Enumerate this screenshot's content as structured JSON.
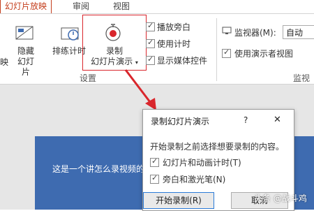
{
  "tabs": [
    {
      "label": "幻灯片放映",
      "active": true
    },
    {
      "label": "审阅",
      "active": false
    },
    {
      "label": "视图",
      "active": false
    }
  ],
  "ribbon": {
    "left_partial": "映",
    "hide_slide": {
      "line1": "隐藏",
      "line2": "幻灯片"
    },
    "rehearse": "排练计时",
    "record": {
      "line1": "录制",
      "line2": "幻灯片演示"
    },
    "checkboxes": [
      {
        "label": "播放旁白",
        "checked": true
      },
      {
        "label": "使用计时",
        "checked": true
      },
      {
        "label": "显示媒体控件",
        "checked": true
      }
    ],
    "monitor_label": "监视器(M):",
    "monitor_value": "自动",
    "presenter_view": {
      "label": "使用演示者视图",
      "checked": true
    },
    "group_setup": "设置",
    "group_monitor_partial": "监视器"
  },
  "slide": {
    "text": "这是一个讲怎么录视频的"
  },
  "dialog": {
    "title": "录制幻灯片演示",
    "help": "?",
    "close": "✕",
    "instruction": "开始录制之前选择想要录制的内容。",
    "options": [
      {
        "label": "幻灯片和动画计时(T)",
        "checked": true
      },
      {
        "label": "旁白和激光笔(N)",
        "checked": true
      }
    ],
    "start_button": "开始录制(R)",
    "cancel_button": "取消"
  },
  "watermark": "头条 @战斗鸡",
  "colors": {
    "accent": "#c43e1c",
    "highlight": "#d9262c",
    "slide": "#3e6bb0"
  }
}
